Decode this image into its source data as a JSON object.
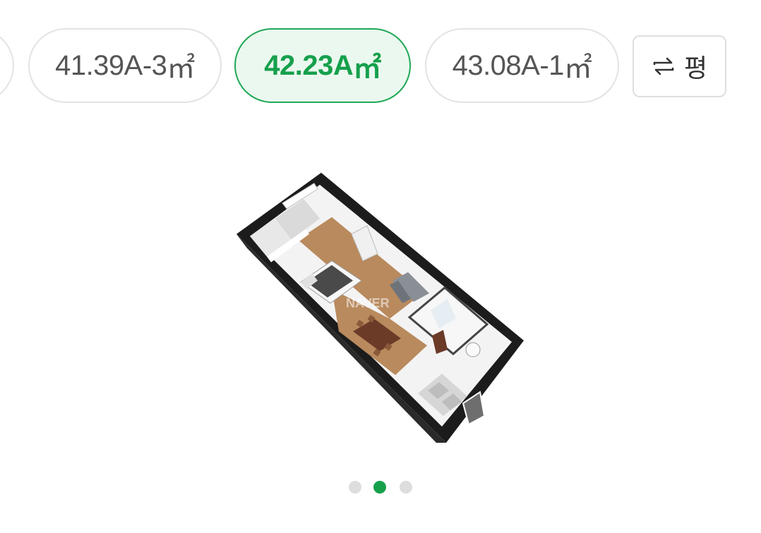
{
  "area_tabs": [
    {
      "label": "41.39A-3",
      "unit": "㎡",
      "selected": false
    },
    {
      "label": "42.23A",
      "unit": "㎡",
      "selected": true
    },
    {
      "label": "43.08A-1",
      "unit": "㎡",
      "selected": false
    }
  ],
  "unit_toggle": {
    "icon": "swap-icon",
    "label": "평"
  },
  "floorplan": {
    "watermark": "NAVER"
  },
  "pagination": {
    "total": 3,
    "current": 2
  },
  "colors": {
    "accent": "#16a04c",
    "accent_bg": "#ebf8ef",
    "border": "#e3e3e3"
  }
}
